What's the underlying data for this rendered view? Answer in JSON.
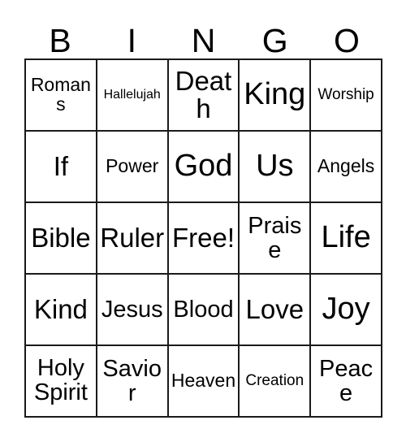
{
  "card": {
    "title": "BINGO",
    "free_space_label": "Free!",
    "colors": {
      "background": "#ffffff",
      "border": "#1a1a1a",
      "text": "#000000"
    },
    "header": {
      "letters": [
        "B",
        "I",
        "N",
        "G",
        "O"
      ]
    },
    "grid": {
      "columns": 5,
      "rows": 5,
      "cells": [
        [
          {
            "label": "Romans",
            "size": "sm"
          },
          {
            "label": "Hallelujah",
            "size": "xxs"
          },
          {
            "label": "Death",
            "size": "lg"
          },
          {
            "label": "King",
            "size": "xl"
          },
          {
            "label": "Worship",
            "size": "xs"
          }
        ],
        [
          {
            "label": "If",
            "size": "lg"
          },
          {
            "label": "Power",
            "size": "sm"
          },
          {
            "label": "God",
            "size": "xl"
          },
          {
            "label": "Us",
            "size": "xl"
          },
          {
            "label": "Angels",
            "size": "sm"
          }
        ],
        [
          {
            "label": "Bible",
            "size": "lg"
          },
          {
            "label": "Ruler",
            "size": "lg"
          },
          {
            "label": "Free!",
            "size": "lg"
          },
          {
            "label": "Praise",
            "size": "md"
          },
          {
            "label": "Life",
            "size": "xl"
          }
        ],
        [
          {
            "label": "Kind",
            "size": "lg"
          },
          {
            "label": "Jesus",
            "size": "md"
          },
          {
            "label": "Blood",
            "size": "md"
          },
          {
            "label": "Love",
            "size": "lg"
          },
          {
            "label": "Joy",
            "size": "xl"
          }
        ],
        [
          {
            "label": "Holy Spirit",
            "size": "md",
            "multiline": true
          },
          {
            "label": "Savior",
            "size": "md"
          },
          {
            "label": "Heaven",
            "size": "sm"
          },
          {
            "label": "Creation",
            "size": "xs"
          },
          {
            "label": "Peace",
            "size": "md"
          }
        ]
      ]
    }
  }
}
